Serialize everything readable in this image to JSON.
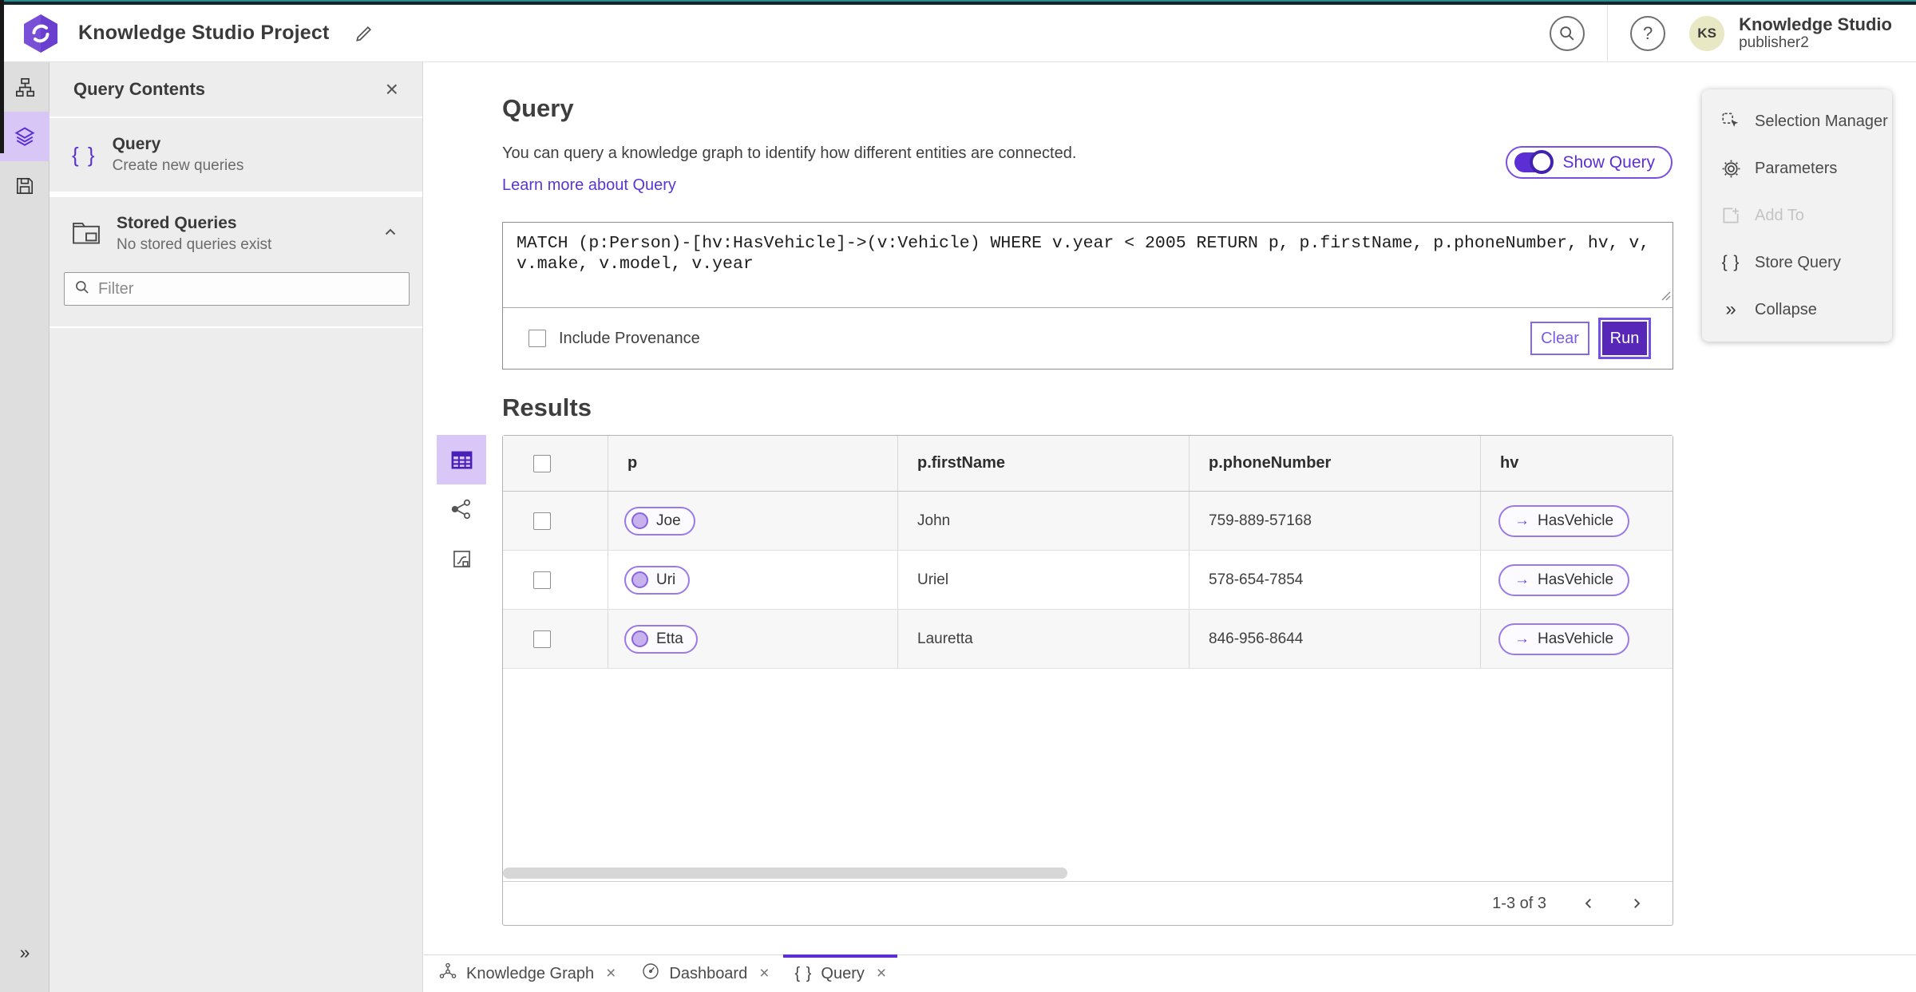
{
  "topbar": {
    "project_title": "Knowledge Studio Project",
    "app_name": "Knowledge Studio",
    "user_name": "publisher2",
    "avatar_initials": "KS"
  },
  "icons": {
    "close": "×",
    "collapse_chevrons": "»",
    "braces": "{ }",
    "arrow_right": "→",
    "help": "?"
  },
  "panel": {
    "title": "Query Contents",
    "query_item": {
      "title": "Query",
      "subtitle": "Create new queries"
    },
    "stored_item": {
      "title": "Stored Queries",
      "subtitle": "No stored queries exist"
    },
    "filter_placeholder": "Filter"
  },
  "query": {
    "title": "Query",
    "description": "You can query a knowledge graph to identify how different entities are connected.",
    "link": "Learn more about Query",
    "toggle_label": "Show Query",
    "text": "MATCH (p:Person)-[hv:HasVehicle]->(v:Vehicle) WHERE v.year < 2005 RETURN p, p.firstName, p.phoneNumber, hv, v, v.make, v.model, v.year",
    "checkbox_label": "Include Provenance",
    "clear_label": "Clear",
    "run_label": "Run"
  },
  "results": {
    "title": "Results",
    "columns": [
      "p",
      "p.firstName",
      "p.phoneNumber",
      "hv"
    ],
    "rows": [
      {
        "p": "Joe",
        "firstName": "John",
        "phoneNumber": "759-889-57168",
        "hv": "HasVehicle"
      },
      {
        "p": "Uri",
        "firstName": "Uriel",
        "phoneNumber": "578-654-7854",
        "hv": "HasVehicle"
      },
      {
        "p": "Etta",
        "firstName": "Lauretta",
        "phoneNumber": "846-956-8644",
        "hv": "HasVehicle"
      }
    ],
    "pagination": "1-3 of 3"
  },
  "context_menu": {
    "items": [
      {
        "label": "Selection Manager"
      },
      {
        "label": "Parameters"
      },
      {
        "label": "Add To"
      },
      {
        "label": "Store Query"
      },
      {
        "label": "Collapse"
      }
    ]
  },
  "tabs": [
    {
      "label": "Knowledge Graph"
    },
    {
      "label": "Dashboard"
    },
    {
      "label": "Query"
    }
  ],
  "colors": {
    "accent": "#5b2fd4",
    "teal_strip": "#2e8a8e",
    "selected_bg": "#d8c6f6"
  }
}
